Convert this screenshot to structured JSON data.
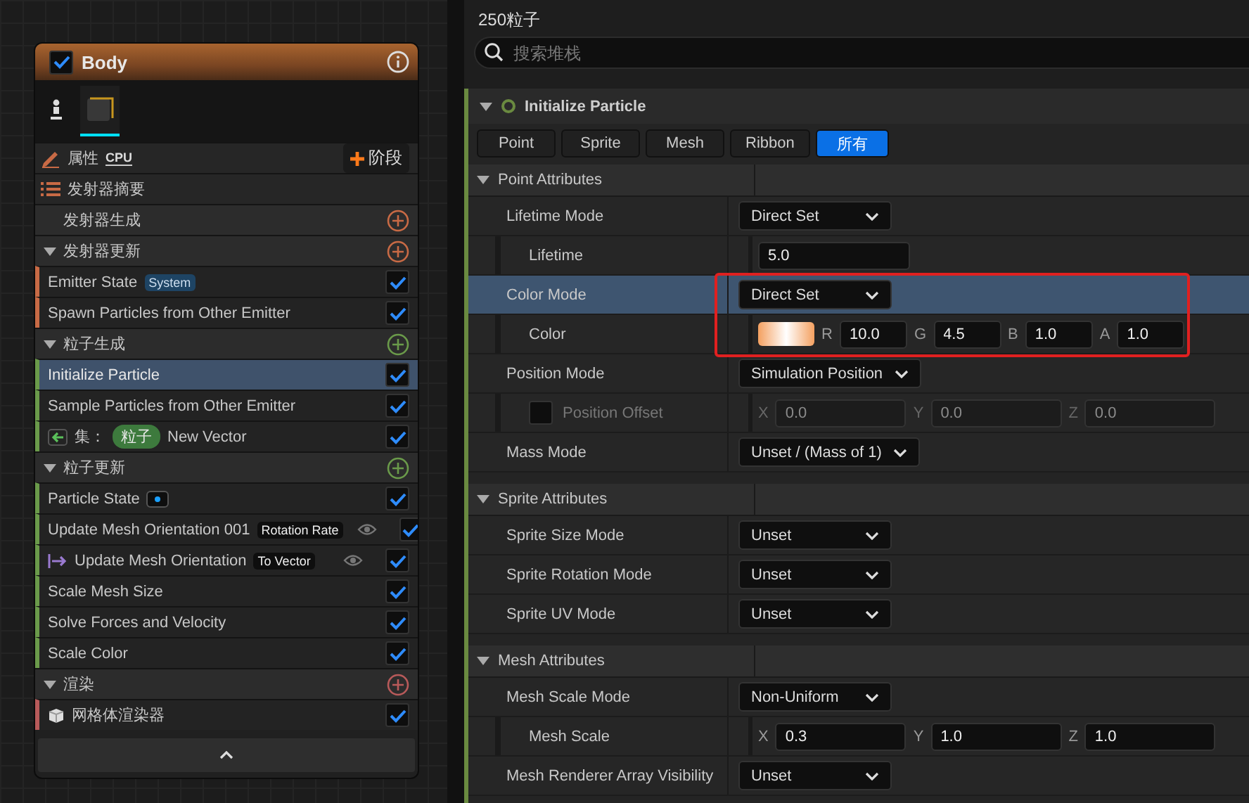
{
  "node": {
    "title": "Body",
    "enabled": true,
    "thumbnails": [
      {
        "kind": "person",
        "selected": false
      },
      {
        "kind": "mesh",
        "selected": true
      }
    ],
    "properties_row": {
      "label": "属性",
      "badge": "CPU",
      "button": "阶段"
    },
    "summary_row": {
      "label": "发射器摘要"
    },
    "groups": [
      {
        "title": "发射器生成",
        "color": "#c86a45"
      },
      {
        "title": "发射器更新",
        "color": "#c86a45",
        "items": [
          {
            "kind": "module",
            "label": "Emitter State",
            "tag": {
              "kind": "scope",
              "text": "System"
            },
            "eye": false,
            "enabled": true,
            "selected": false
          },
          {
            "kind": "module",
            "label": "Spawn Particles from Other Emitter",
            "eye": false,
            "enabled": true,
            "selected": false
          }
        ]
      },
      {
        "title": "粒子生成",
        "color": "#6a9a4a",
        "items": [
          {
            "kind": "module",
            "label": "Initialize Particle",
            "eye": false,
            "enabled": true,
            "selected": true
          },
          {
            "kind": "module",
            "label": "Sample Particles from Other Emitter",
            "eye": false,
            "enabled": true,
            "selected": false
          },
          {
            "kind": "set",
            "prefix": "集：",
            "chip": "粒子",
            "label": "New Vector",
            "eye": false,
            "enabled": true,
            "selected": false
          }
        ]
      },
      {
        "title": "粒子更新",
        "color": "#6a9a4a",
        "items": [
          {
            "kind": "module",
            "label": "Particle State",
            "tag": {
              "kind": "dot"
            },
            "eye": false,
            "enabled": true,
            "selected": false
          },
          {
            "kind": "module",
            "label": "Update Mesh Orientation 001",
            "tag": {
              "kind": "input",
              "text": "Rotation Rate"
            },
            "eye": true,
            "enabled": true,
            "selected": false
          },
          {
            "kind": "linked",
            "label": "Update Mesh Orientation",
            "tag": {
              "kind": "input",
              "text": "To Vector"
            },
            "eye": true,
            "enabled": true,
            "selected": false
          },
          {
            "kind": "module",
            "label": "Scale Mesh Size",
            "eye": false,
            "enabled": true,
            "selected": false
          },
          {
            "kind": "module",
            "label": "Solve Forces and Velocity",
            "eye": false,
            "enabled": true,
            "selected": false
          },
          {
            "kind": "module",
            "label": "Scale Color",
            "eye": false,
            "enabled": true,
            "selected": false
          }
        ]
      },
      {
        "title": "渲染",
        "color": "#b85a5a",
        "items": [
          {
            "kind": "renderer",
            "label": "网格体渲染器",
            "eye": false,
            "enabled": true,
            "selected": false
          }
        ]
      }
    ]
  },
  "panel": {
    "title": "250粒子",
    "search": {
      "placeholder": "搜索堆栈"
    },
    "module_title": "Initialize Particle",
    "tabs": [
      {
        "label": "Point",
        "selected": false
      },
      {
        "label": "Sprite",
        "selected": false
      },
      {
        "label": "Mesh",
        "selected": false
      },
      {
        "label": "Ribbon",
        "selected": false
      },
      {
        "label": "所有",
        "selected": true
      }
    ],
    "sections": [
      {
        "title": "Point Attributes",
        "rows": [
          {
            "label": "Lifetime Mode",
            "kind": "dropdown",
            "value": "Direct Set",
            "selected": false,
            "children": [
              {
                "label": "Lifetime",
                "kind": "number",
                "value": "5.0",
                "selected": false
              }
            ]
          },
          {
            "label": "Color Mode",
            "kind": "dropdown",
            "value": "Direct Set",
            "selected": true,
            "outlined": true,
            "children": [
              {
                "label": "Color",
                "kind": "color",
                "fields": [
                  {
                    "axis": "R",
                    "value": "10.0"
                  },
                  {
                    "axis": "G",
                    "value": "4.5"
                  },
                  {
                    "axis": "B",
                    "value": "1.0"
                  },
                  {
                    "axis": "A",
                    "value": "1.0"
                  }
                ],
                "selected": false
              }
            ]
          },
          {
            "label": "Position Mode",
            "kind": "dropdown",
            "value": "Simulation Position",
            "selected": false,
            "children": [
              {
                "label": "Position Offset",
                "kind": "vector",
                "checked": false,
                "disabled": true,
                "fields": [
                  {
                    "axis": "X",
                    "value": "0.0"
                  },
                  {
                    "axis": "Y",
                    "value": "0.0"
                  },
                  {
                    "axis": "Z",
                    "value": "0.0"
                  }
                ],
                "selected": false
              }
            ]
          },
          {
            "label": "Mass Mode",
            "kind": "dropdown",
            "value": "Unset / (Mass of 1)",
            "selected": false
          }
        ]
      },
      {
        "title": "Sprite Attributes",
        "rows": [
          {
            "label": "Sprite Size Mode",
            "kind": "dropdown",
            "value": "Unset",
            "selected": false
          },
          {
            "label": "Sprite Rotation Mode",
            "kind": "dropdown",
            "value": "Unset",
            "selected": false
          },
          {
            "label": "Sprite UV Mode",
            "kind": "dropdown",
            "value": "Unset",
            "selected": false
          }
        ]
      },
      {
        "title": "Mesh Attributes",
        "rows": [
          {
            "label": "Mesh Scale Mode",
            "kind": "dropdown",
            "value": "Non-Uniform",
            "selected": false,
            "children": [
              {
                "label": "Mesh Scale",
                "kind": "vector",
                "fields": [
                  {
                    "axis": "X",
                    "value": "0.3"
                  },
                  {
                    "axis": "Y",
                    "value": "1.0"
                  },
                  {
                    "axis": "Z",
                    "value": "1.0"
                  }
                ],
                "selected": false
              }
            ]
          },
          {
            "label": "Mesh Renderer Array Visibility",
            "kind": "dropdown",
            "value": "Unset",
            "selected": false
          }
        ]
      }
    ]
  }
}
